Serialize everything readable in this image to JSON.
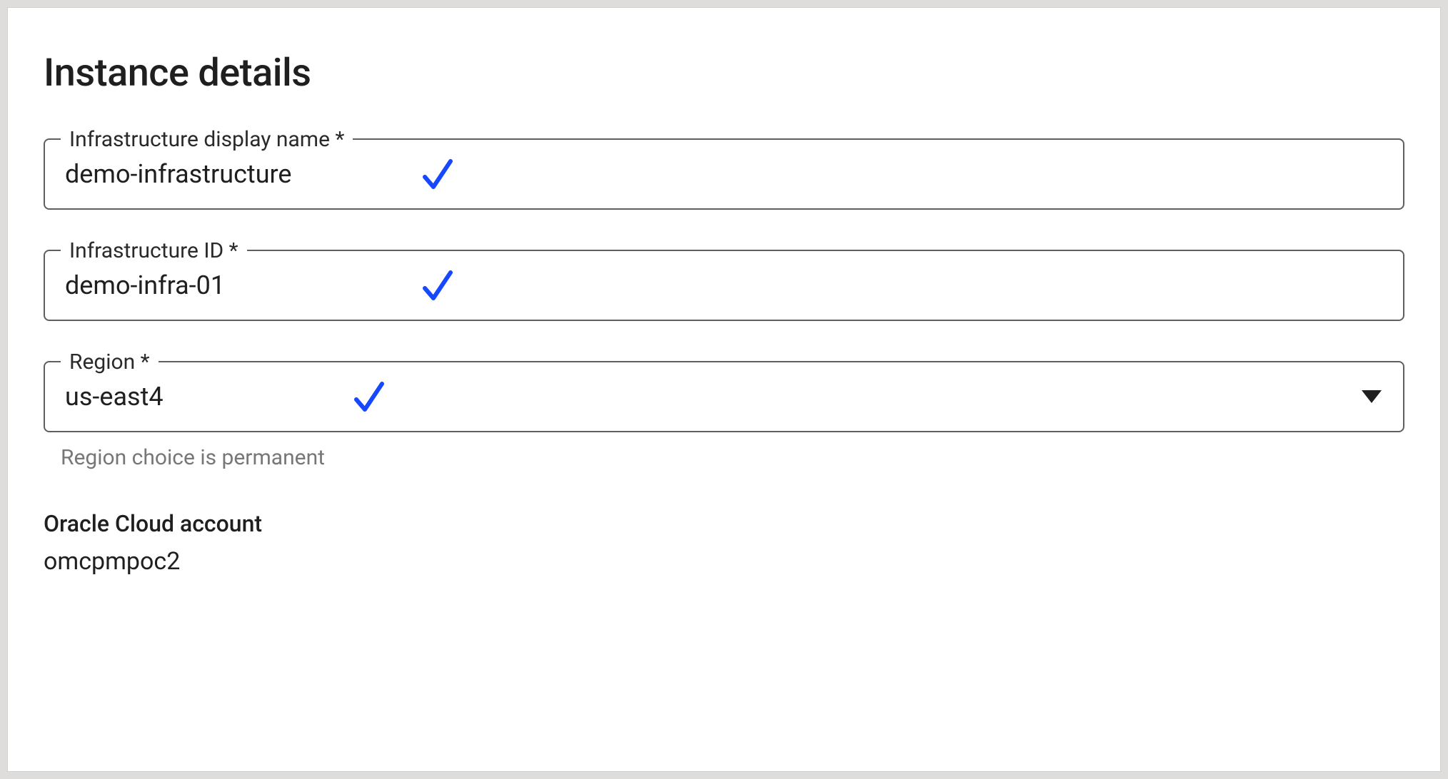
{
  "title": "Instance details",
  "fields": {
    "display_name": {
      "label": "Infrastructure display name *",
      "value": "demo-infrastructure"
    },
    "infra_id": {
      "label": "Infrastructure ID *",
      "value": "demo-infra-01"
    },
    "region": {
      "label": "Region *",
      "value": "us-east4",
      "helper": "Region choice is permanent"
    }
  },
  "account": {
    "label": "Oracle Cloud account",
    "value": "omcpmpoc2"
  }
}
